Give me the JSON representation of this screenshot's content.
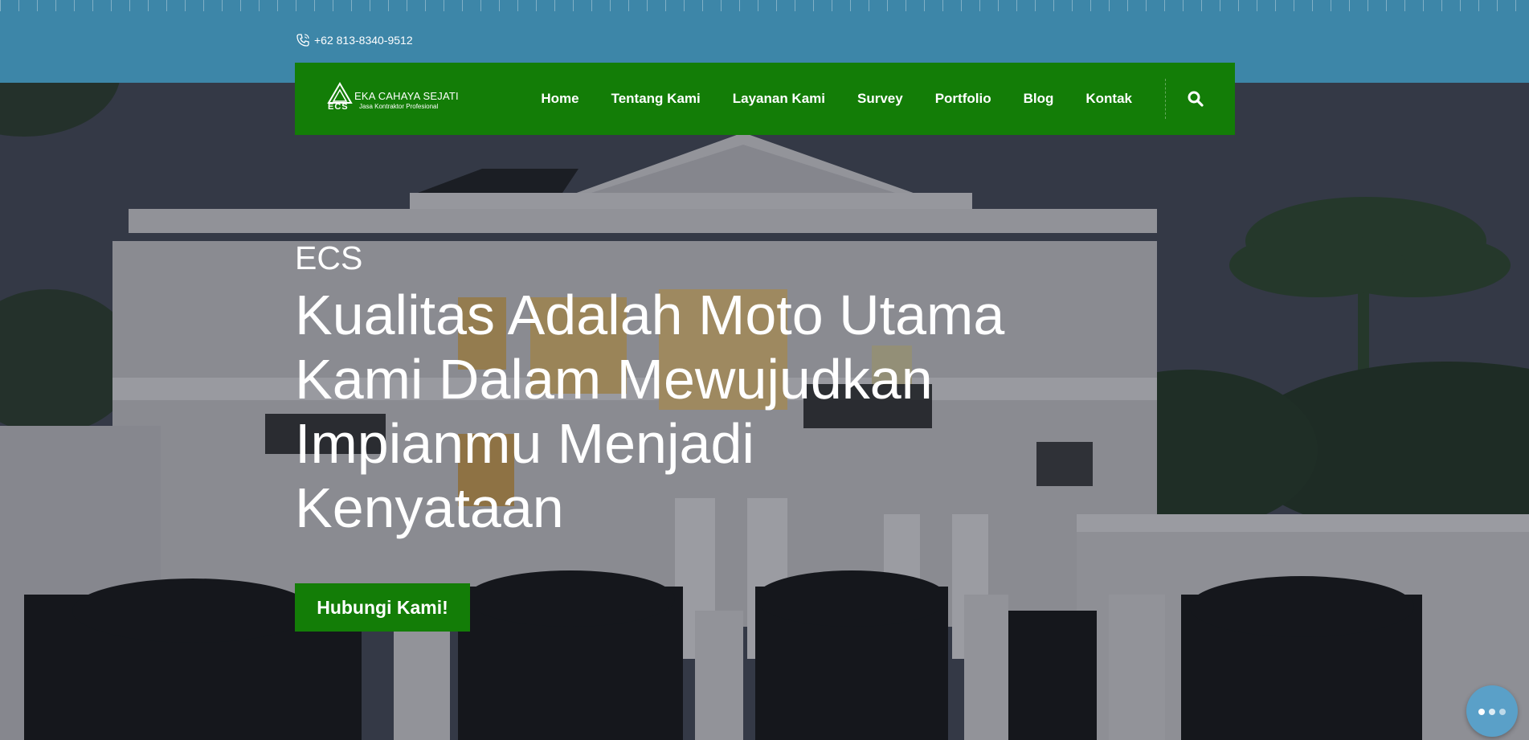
{
  "topbar": {
    "phone": "+62 813-8340-9512",
    "phone_icon": "phone-icon"
  },
  "brand": {
    "name": "EKA CAHAYA SEJATI",
    "tagline": "Jasa Kontraktor Profesional",
    "abbr": "ECS"
  },
  "nav": {
    "items": [
      {
        "label": "Home"
      },
      {
        "label": "Tentang Kami"
      },
      {
        "label": "Layanan Kami"
      },
      {
        "label": "Survey"
      },
      {
        "label": "Portfolio"
      },
      {
        "label": "Blog"
      },
      {
        "label": "Kontak"
      }
    ],
    "search_icon": "search-icon"
  },
  "hero": {
    "kicker": "ECS",
    "headline": "Kualitas Adalah Moto Utama Kami Dalam Mewujudkan Impianmu Menjadi Kenyataan",
    "cta_label": "Hubungi Kami!"
  },
  "chat": {
    "icon": "chat-icon"
  },
  "colors": {
    "topbar": "#3d86a8",
    "nav_green": "#137d07",
    "text": "#ffffff"
  }
}
